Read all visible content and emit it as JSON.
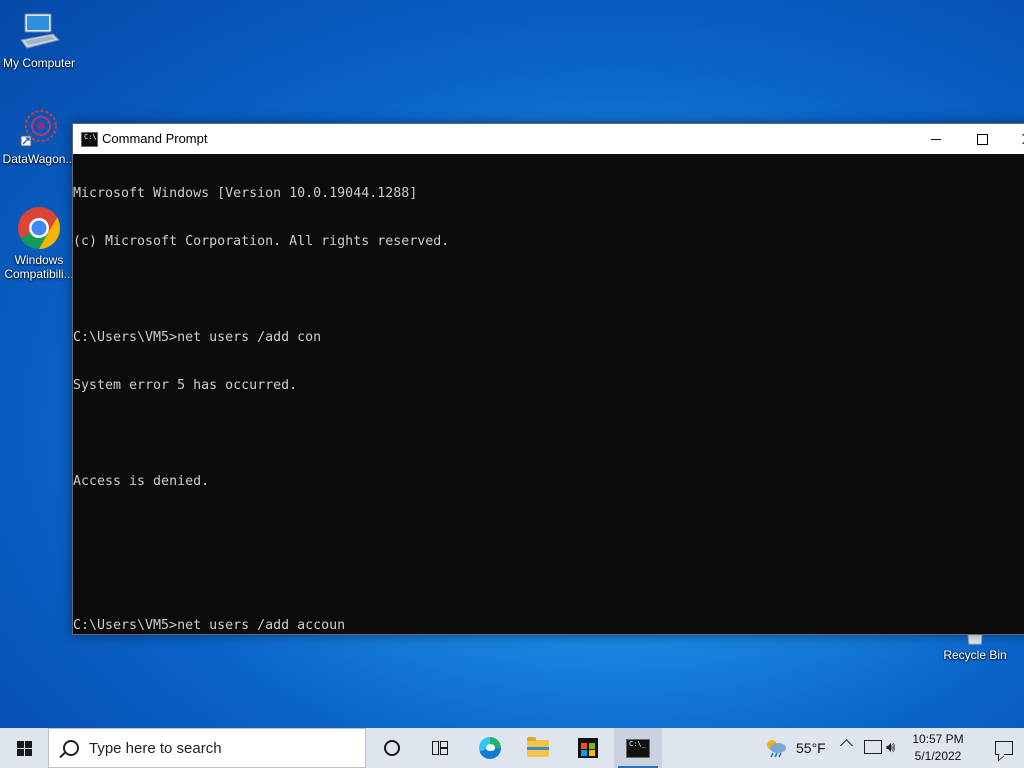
{
  "desktop": {
    "icons": [
      {
        "label": "My Computer"
      },
      {
        "label": "DataWagon..."
      },
      {
        "label": "Windows Compatibili..."
      },
      {
        "label": "Recycle Bin"
      }
    ]
  },
  "window": {
    "title": "Command Prompt",
    "console_lines": [
      "Microsoft Windows [Version 10.0.19044.1288]",
      "(c) Microsoft Corporation. All rights reserved.",
      "",
      "C:\\Users\\VM5>net users /add con",
      "System error 5 has occurred.",
      "",
      "Access is denied.",
      "",
      "",
      "C:\\Users\\VM5>net users /add accoun"
    ],
    "background_color": "#0c0c0c",
    "text_color": "#cccccc"
  },
  "taskbar": {
    "search_placeholder": "Type here to search",
    "pinned": [
      "cortana-icon",
      "task-view-icon",
      "edge-icon",
      "file-explorer-icon",
      "store-icon",
      "command-prompt-icon"
    ],
    "active_app": "command-prompt-icon",
    "weather": "55°F",
    "time": "10:57 PM",
    "date": "5/1/2022",
    "accent_color": "#2f6fb5"
  }
}
